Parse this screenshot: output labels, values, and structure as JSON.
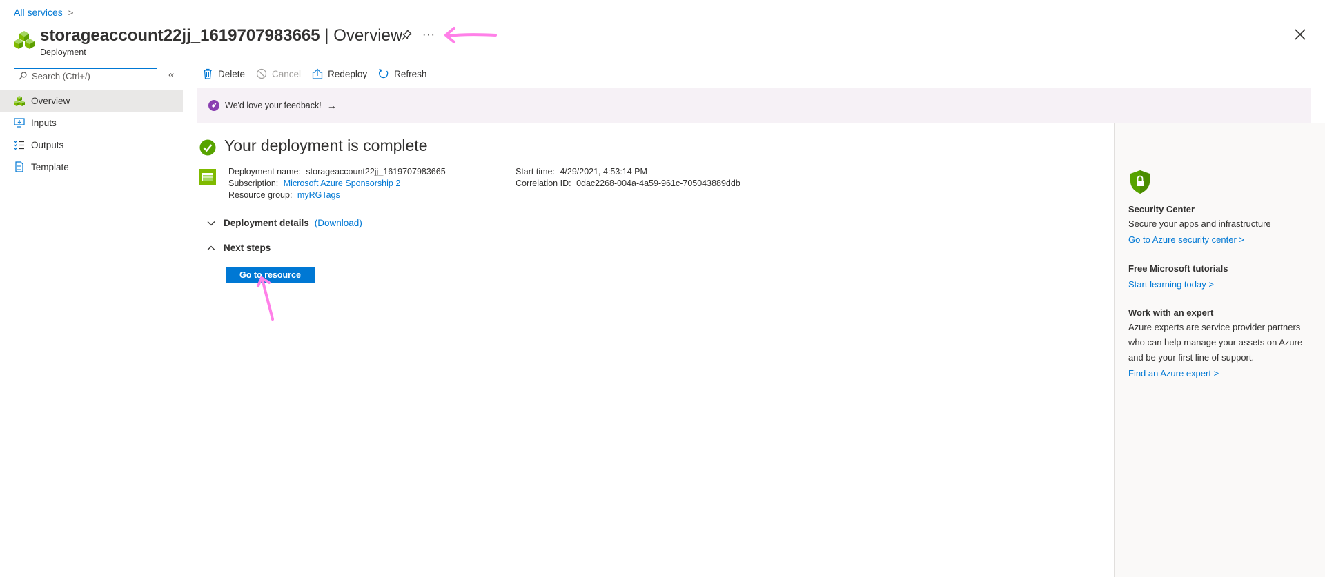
{
  "breadcrumb": {
    "all_services": "All services",
    "separator": ">"
  },
  "header": {
    "resource_name": "storageaccount22jj_1619707983665",
    "separator": " | ",
    "view": "Overview",
    "subtitle": "Deployment",
    "more_label": "···",
    "icons": {
      "resource": "deployment-cubes-icon",
      "pin": "pin-icon",
      "close": "close-icon"
    }
  },
  "sidebar": {
    "search": {
      "placeholder": "Search (Ctrl+/)",
      "value": ""
    },
    "collapse_label": "«",
    "items": [
      {
        "label": "Overview",
        "icon": "overview-icon",
        "active": true
      },
      {
        "label": "Inputs",
        "icon": "inputs-icon",
        "active": false
      },
      {
        "label": "Outputs",
        "icon": "outputs-icon",
        "active": false
      },
      {
        "label": "Template",
        "icon": "template-icon",
        "active": false
      }
    ]
  },
  "toolbar": {
    "delete": "Delete",
    "cancel": "Cancel",
    "redeploy": "Redeploy",
    "refresh": "Refresh"
  },
  "feedback": {
    "text": "We'd love your feedback!",
    "arrow": "→"
  },
  "main": {
    "status_title": "Your deployment is complete",
    "details": {
      "deployment_name_key": "Deployment name:",
      "deployment_name": "storageaccount22jj_1619707983665",
      "subscription_key": "Subscription:",
      "subscription": "Microsoft Azure Sponsorship 2",
      "resource_group_key": "Resource group:",
      "resource_group": "myRGTags",
      "start_time_key": "Start time:",
      "start_time": "4/29/2021, 4:53:14 PM",
      "correlation_key": "Correlation ID:",
      "correlation_id": "0dac2268-004a-4a59-961c-705043889ddb"
    },
    "deployment_details": {
      "title": "Deployment details",
      "download": "(Download)",
      "expanded": false
    },
    "next_steps": {
      "title": "Next steps",
      "expanded": true
    },
    "go_to_resource": "Go to resource"
  },
  "right_panel": {
    "security": {
      "title": "Security Center",
      "text": "Secure your apps and infrastructure",
      "link": "Go to Azure security center >"
    },
    "tutorials": {
      "title": "Free Microsoft tutorials",
      "link": "Start learning today >"
    },
    "expert": {
      "title": "Work with an expert",
      "text": "Azure experts are service provider partners who can help manage your assets on Azure and be your first line of support.",
      "link": "Find an Azure expert >"
    }
  },
  "colors": {
    "accent": "#0078d4",
    "success": "#57a300",
    "annotation": "#ff80e8",
    "feedback_bg": "#f6f1f6",
    "feedback_icon": "#8a3fb1"
  }
}
